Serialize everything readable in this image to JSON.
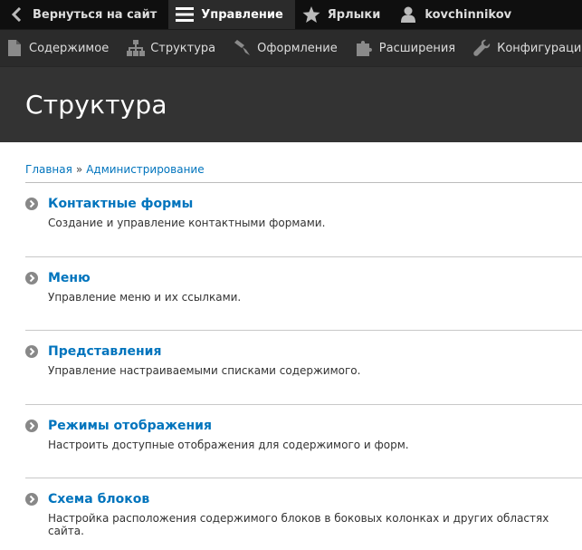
{
  "toolbar": {
    "back_to_site": "Вернуться на сайт",
    "manage": "Управление",
    "shortcuts": "Ярлыки",
    "user": "kovchinnikov"
  },
  "tray": {
    "items": [
      {
        "label": "Содержимое",
        "icon": "file-icon"
      },
      {
        "label": "Структура",
        "icon": "sitemap-icon"
      },
      {
        "label": "Оформление",
        "icon": "paintbrush-icon"
      },
      {
        "label": "Расширения",
        "icon": "puzzle-icon"
      },
      {
        "label": "Конфигурация",
        "icon": "wrench-icon"
      }
    ]
  },
  "page": {
    "title": "Структура"
  },
  "breadcrumb": {
    "home": "Главная",
    "separator": "»",
    "admin": "Администрирование"
  },
  "admin_list": [
    {
      "title": "Контактные формы",
      "description": "Создание и управление контактными формами."
    },
    {
      "title": "Меню",
      "description": "Управление меню и их ссылками."
    },
    {
      "title": "Представления",
      "description": "Управление настраиваемыми списками содержимого."
    },
    {
      "title": "Режимы отображения",
      "description": "Настроить доступные отображения для содержимого и форм."
    },
    {
      "title": "Схема блоков",
      "description": "Настройка расположения содержимого блоков в боковых колонках и других областях сайта."
    }
  ],
  "colors": {
    "toolbar_bg": "#0f0f0f",
    "tray_bg": "#2b2b2b",
    "header_bg": "#333333",
    "link": "#0074bd"
  }
}
